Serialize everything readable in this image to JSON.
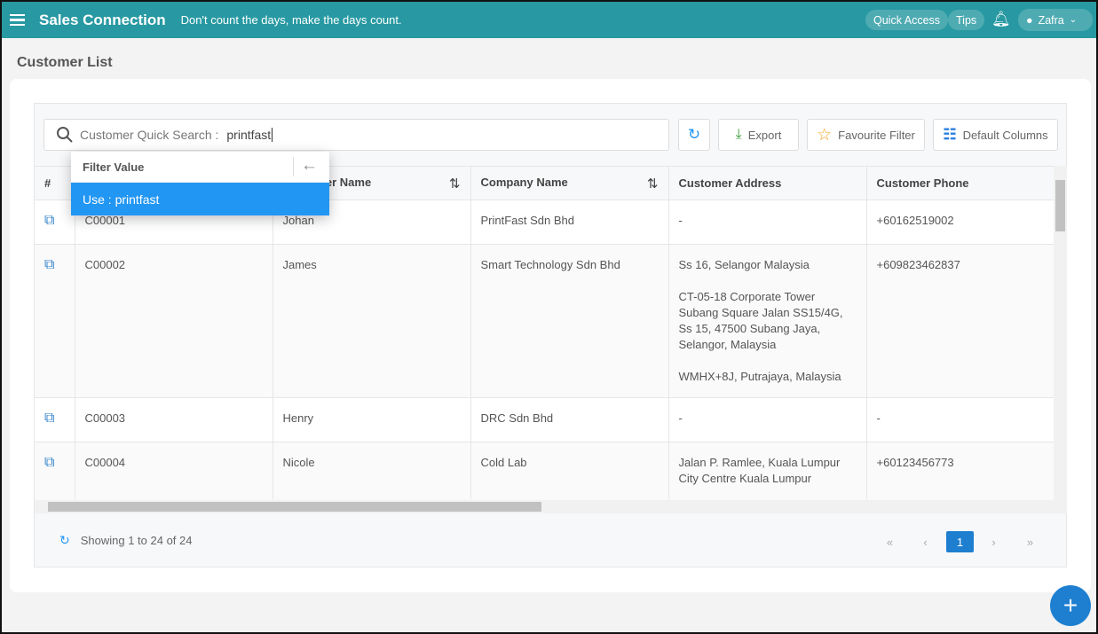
{
  "header": {
    "brand": "Sales Connection",
    "tagline": "Don't count the days, make the days count.",
    "quick_access": "Quick Access",
    "tips": "Tips",
    "user": "Zafra"
  },
  "page": {
    "title": "Customer List"
  },
  "toolbar": {
    "search_label": "Customer Quick Search :",
    "search_value": "printfast",
    "export": "Export",
    "favourite_filter": "Favourite Filter",
    "default_columns": "Default Columns"
  },
  "dropdown": {
    "title": "Filter Value",
    "option": "Use : printfast"
  },
  "columns": [
    "#",
    "",
    "Customer Name",
    "Company Name",
    "Customer Address",
    "Customer Phone"
  ],
  "rows": [
    {
      "code": "C00001",
      "name": "Johan",
      "company": "PrintFast Sdn Bhd",
      "address": [
        "-"
      ],
      "phone": "+60162519002"
    },
    {
      "code": "C00002",
      "name": "James",
      "company": "Smart Technology Sdn Bhd",
      "address": [
        "Ss 16, Selangor Malaysia",
        "CT-05-18 Corporate Tower Subang Square Jalan SS15/4G, Ss 15, 47500 Subang Jaya, Selangor, Malaysia",
        "WMHX+8J, Putrajaya, Malaysia"
      ],
      "phone": "+609823462837"
    },
    {
      "code": "C00003",
      "name": "Henry",
      "company": "DRC Sdn Bhd",
      "address": [
        "-"
      ],
      "phone": "-"
    },
    {
      "code": "C00004",
      "name": "Nicole",
      "company": "Cold Lab",
      "address": [
        "Jalan P. Ramlee, Kuala Lumpur City Centre Kuala Lumpur"
      ],
      "phone": "+60123456773"
    }
  ],
  "footer": {
    "showing": "Showing 1 to 24 of 24",
    "page": "1"
  },
  "colors": {
    "header": "#2899a2",
    "primary": "#1e7fd0",
    "dropdown_active": "#2196f3"
  }
}
